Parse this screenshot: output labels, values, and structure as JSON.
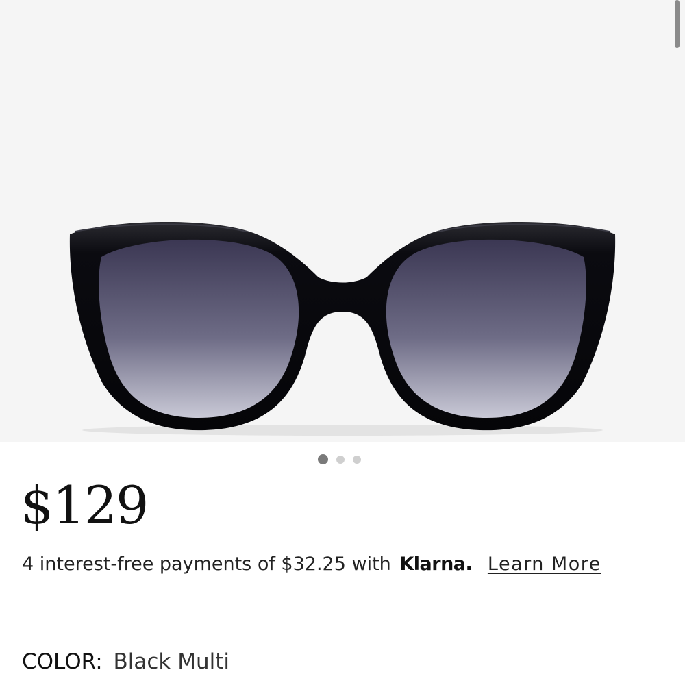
{
  "product": {
    "image_alt": "black cat-eye sunglasses",
    "gallery": {
      "slides": 3,
      "active_index": 0
    },
    "price": "$129",
    "payments": {
      "text": "4 interest-free payments of $32.25 with",
      "provider": "Klarna.",
      "learn_more": "Learn More"
    },
    "color": {
      "label": "COLOR:",
      "value": "Black Multi"
    }
  },
  "colors": {
    "frame": "#0d0d12",
    "lens_top": "#3e3a55",
    "lens_bottom": "#b9b9c9",
    "background": "#f5f5f5"
  }
}
